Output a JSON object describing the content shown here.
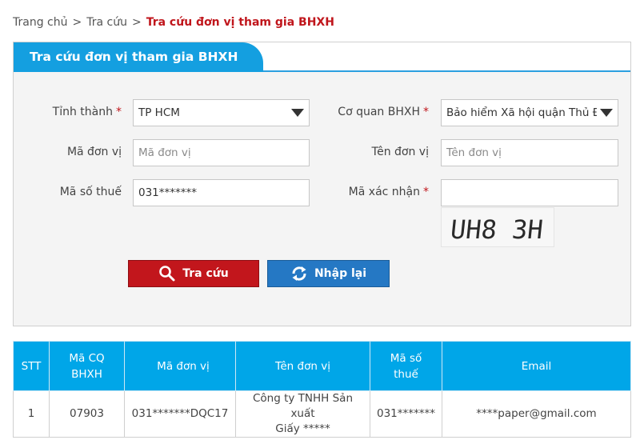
{
  "breadcrumb": {
    "items": [
      "Trang chủ",
      "Tra cứu"
    ],
    "separator": ">",
    "current": "Tra cứu đơn vị tham gia BHXH"
  },
  "panel": {
    "title": "Tra cứu đơn vị tham gia BHXH"
  },
  "form": {
    "province_label": "Tỉnh thành",
    "province_value": "TP HCM",
    "agency_label": "Cơ quan BHXH",
    "agency_value": "Bảo hiểm Xã hội quận Thủ Đức",
    "unit_code_label": "Mã đơn vị",
    "unit_code_placeholder": "Mã đơn vị",
    "unit_name_label": "Tên đơn vị",
    "unit_name_placeholder": "Tên đơn vị",
    "tax_code_label": "Mã số thuế",
    "tax_code_value": "031*******",
    "captcha_label": "Mã xác nhận",
    "captcha_value": "",
    "captcha_text": "UH8 3H",
    "required_mark": "*"
  },
  "buttons": {
    "search_label": "Tra cứu",
    "reset_label": "Nhập lại"
  },
  "colors": {
    "primary_blue": "#149fe0",
    "header_blue": "#00a6e8",
    "danger_red": "#c2161c",
    "button_blue": "#2578c4"
  },
  "table": {
    "headers": {
      "stt": "STT",
      "agency_code_1": "Mã CQ",
      "agency_code_2": "BHXH",
      "unit_code": "Mã đơn vị",
      "unit_name": "Tên đơn vị",
      "tax_code_1": "Mã số",
      "tax_code_2": "thuế",
      "email": "Email"
    },
    "rows": [
      {
        "stt": "1",
        "agency_code": "07903",
        "unit_code": "031*******DQC17",
        "unit_name_1": "Công ty TNHH Sản xuất",
        "unit_name_2": "Giấy *****",
        "tax_code": "031*******",
        "email": "****paper@gmail.com"
      }
    ]
  }
}
